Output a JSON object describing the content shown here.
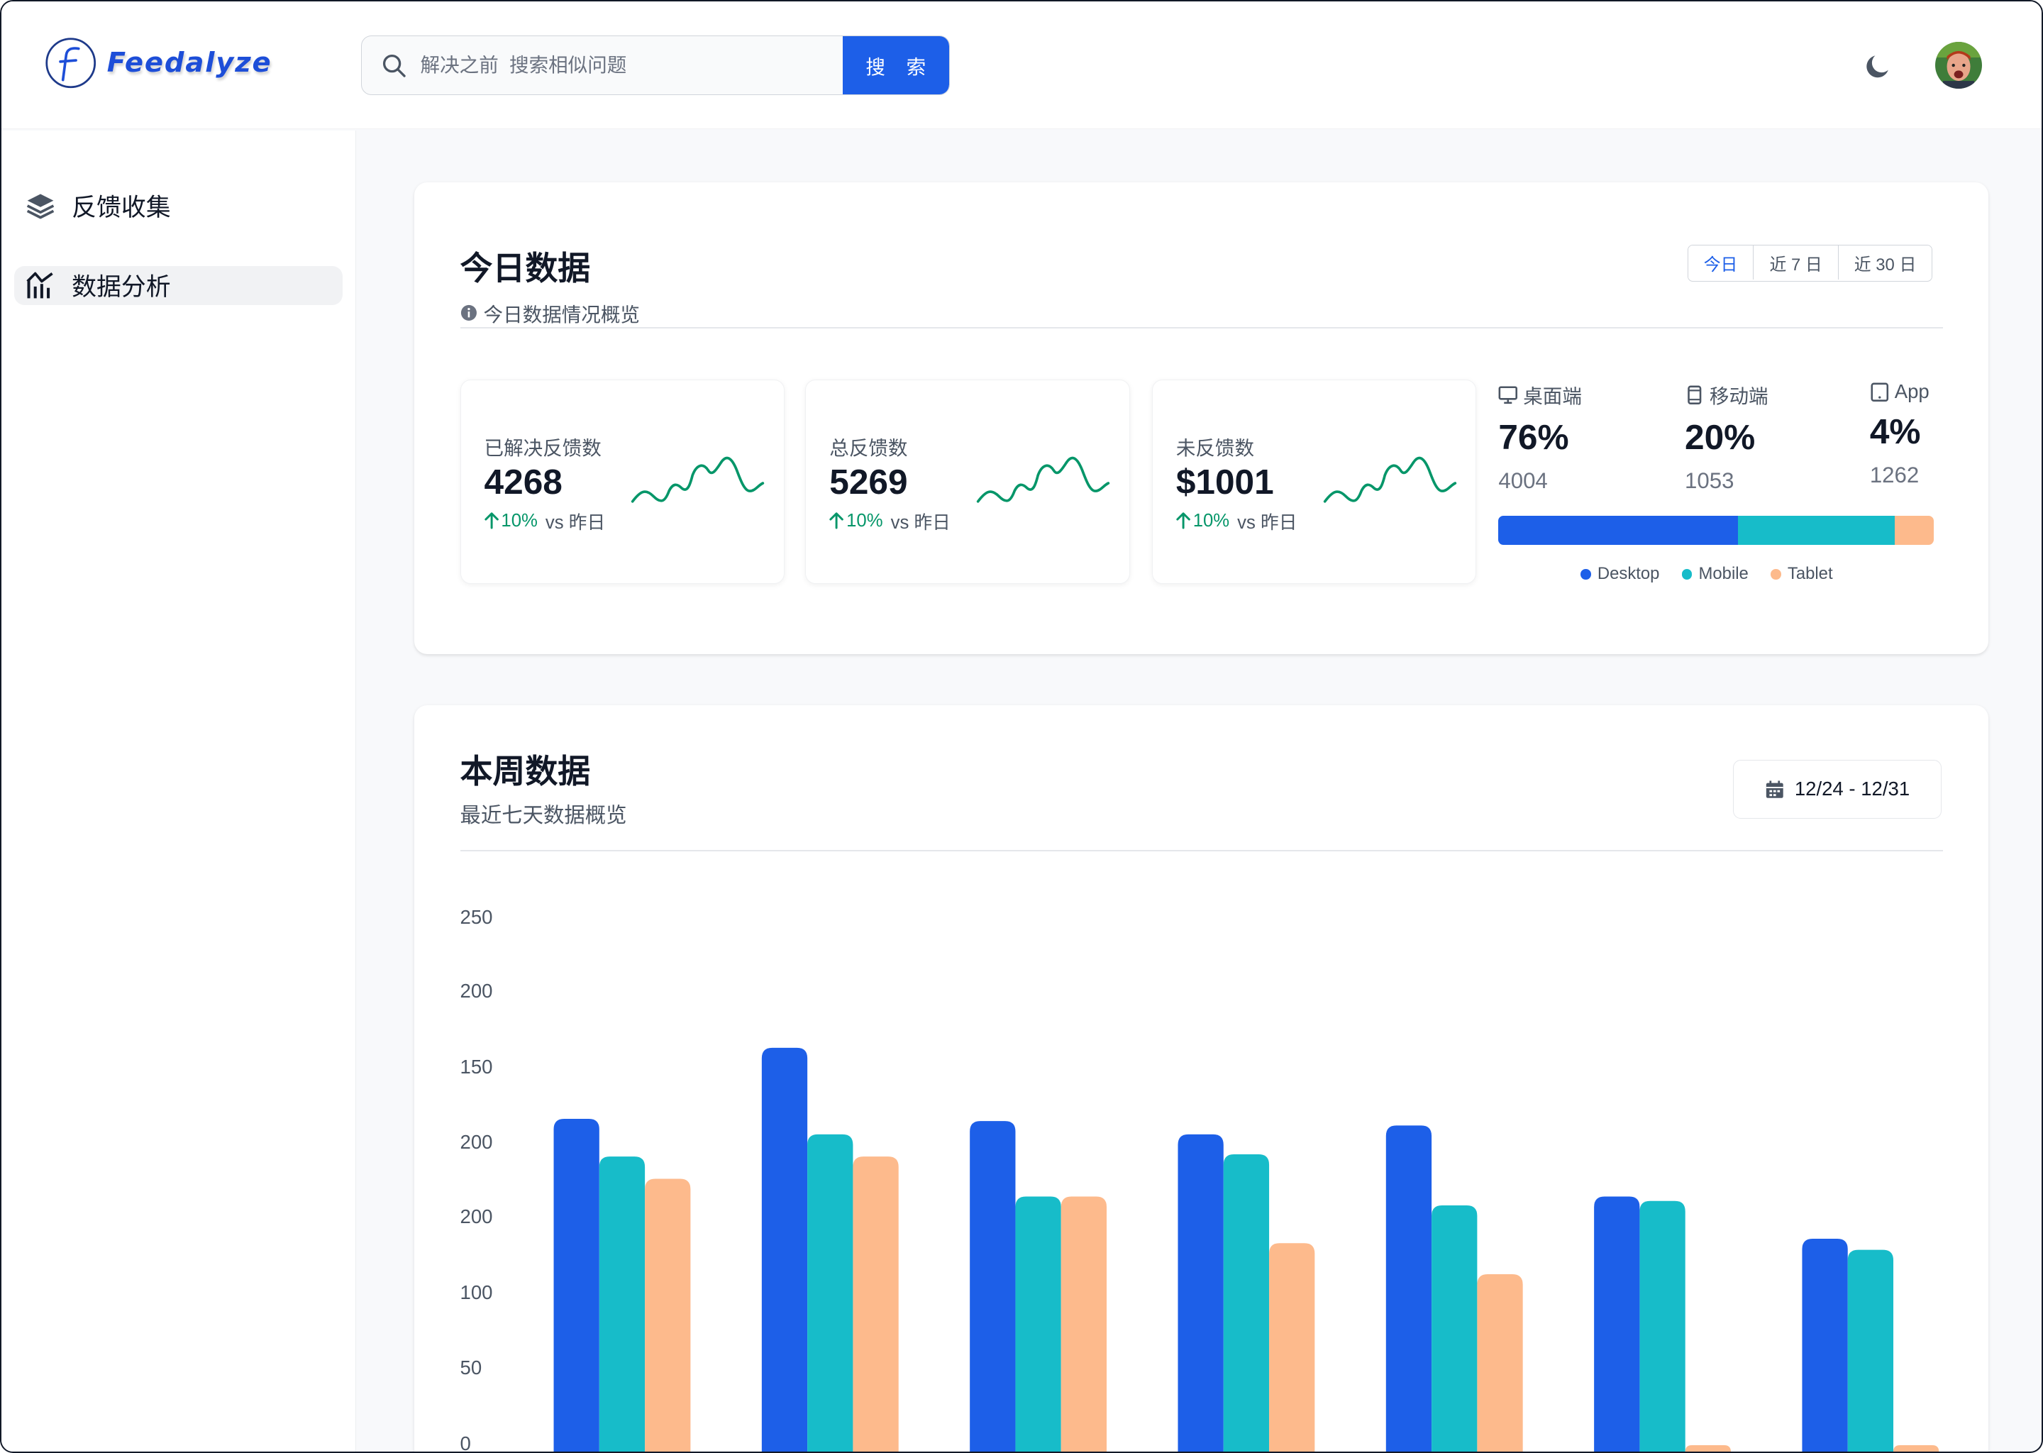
{
  "header": {
    "brand": "Feedalyze",
    "brand_letter": "F",
    "search_placeholder": "解决之前  搜索相似问题",
    "search_button": "搜 索"
  },
  "sidebar": {
    "items": [
      {
        "label": "反馈收集",
        "icon": "layers-icon",
        "active": false
      },
      {
        "label": "数据分析",
        "icon": "analytics-chart-icon",
        "active": true
      }
    ]
  },
  "today": {
    "title": "今日数据",
    "subtitle": "今日数据情况概览",
    "ranges": [
      "今日",
      "近 7 日",
      "近 30 日"
    ],
    "active_range": "今日",
    "stats": [
      {
        "label": "已解决反馈数",
        "value": "4268",
        "trend": "10%",
        "trend_suffix": "vs 昨日"
      },
      {
        "label": "总反馈数",
        "value": "5269",
        "trend": "10%",
        "trend_suffix": "vs 昨日"
      },
      {
        "label": "未反馈数",
        "value": "$1001",
        "trend": "10%",
        "trend_suffix": "vs 昨日"
      }
    ],
    "devices": [
      {
        "name": "桌面端",
        "icon": "monitor-icon",
        "percent": "76%",
        "count": "4004"
      },
      {
        "name": "移动端",
        "icon": "mobile-icon",
        "percent": "20%",
        "count": "1053"
      },
      {
        "name": "App",
        "icon": "tablet-icon",
        "percent": "4%",
        "count": "1262"
      }
    ],
    "device_share": [
      55,
      36,
      9
    ],
    "legend": [
      {
        "name": "Desktop",
        "color": "#1d5fe8"
      },
      {
        "name": "Mobile",
        "color": "#17bcc9"
      },
      {
        "name": "Tablet",
        "color": "#fdba8c"
      }
    ]
  },
  "week": {
    "title": "本周数据",
    "subtitle": "最近七天数据概览",
    "date_range": "12/24 - 12/31"
  },
  "chart_data": {
    "type": "bar",
    "title": "",
    "xlabel": "",
    "ylabel": "",
    "ytick_labels": [
      "250",
      "200",
      "150",
      "200",
      "200",
      "100",
      "50",
      "0"
    ],
    "ylim": [
      0,
      250
    ],
    "categories": [
      "",
      "",
      "",
      "",
      "",
      "",
      ""
    ],
    "series": [
      {
        "name": "Desktop",
        "color": "#1d5fe8",
        "values": [
          150,
          182,
          149,
          143,
          147,
          115,
          96
        ]
      },
      {
        "name": "Mobile",
        "color": "#17bcc9",
        "values": [
          133,
          143,
          115,
          134,
          111,
          113,
          91
        ]
      },
      {
        "name": "Tablet",
        "color": "#fdba8c",
        "values": [
          123,
          133,
          115,
          94,
          80,
          3,
          3
        ]
      }
    ]
  }
}
